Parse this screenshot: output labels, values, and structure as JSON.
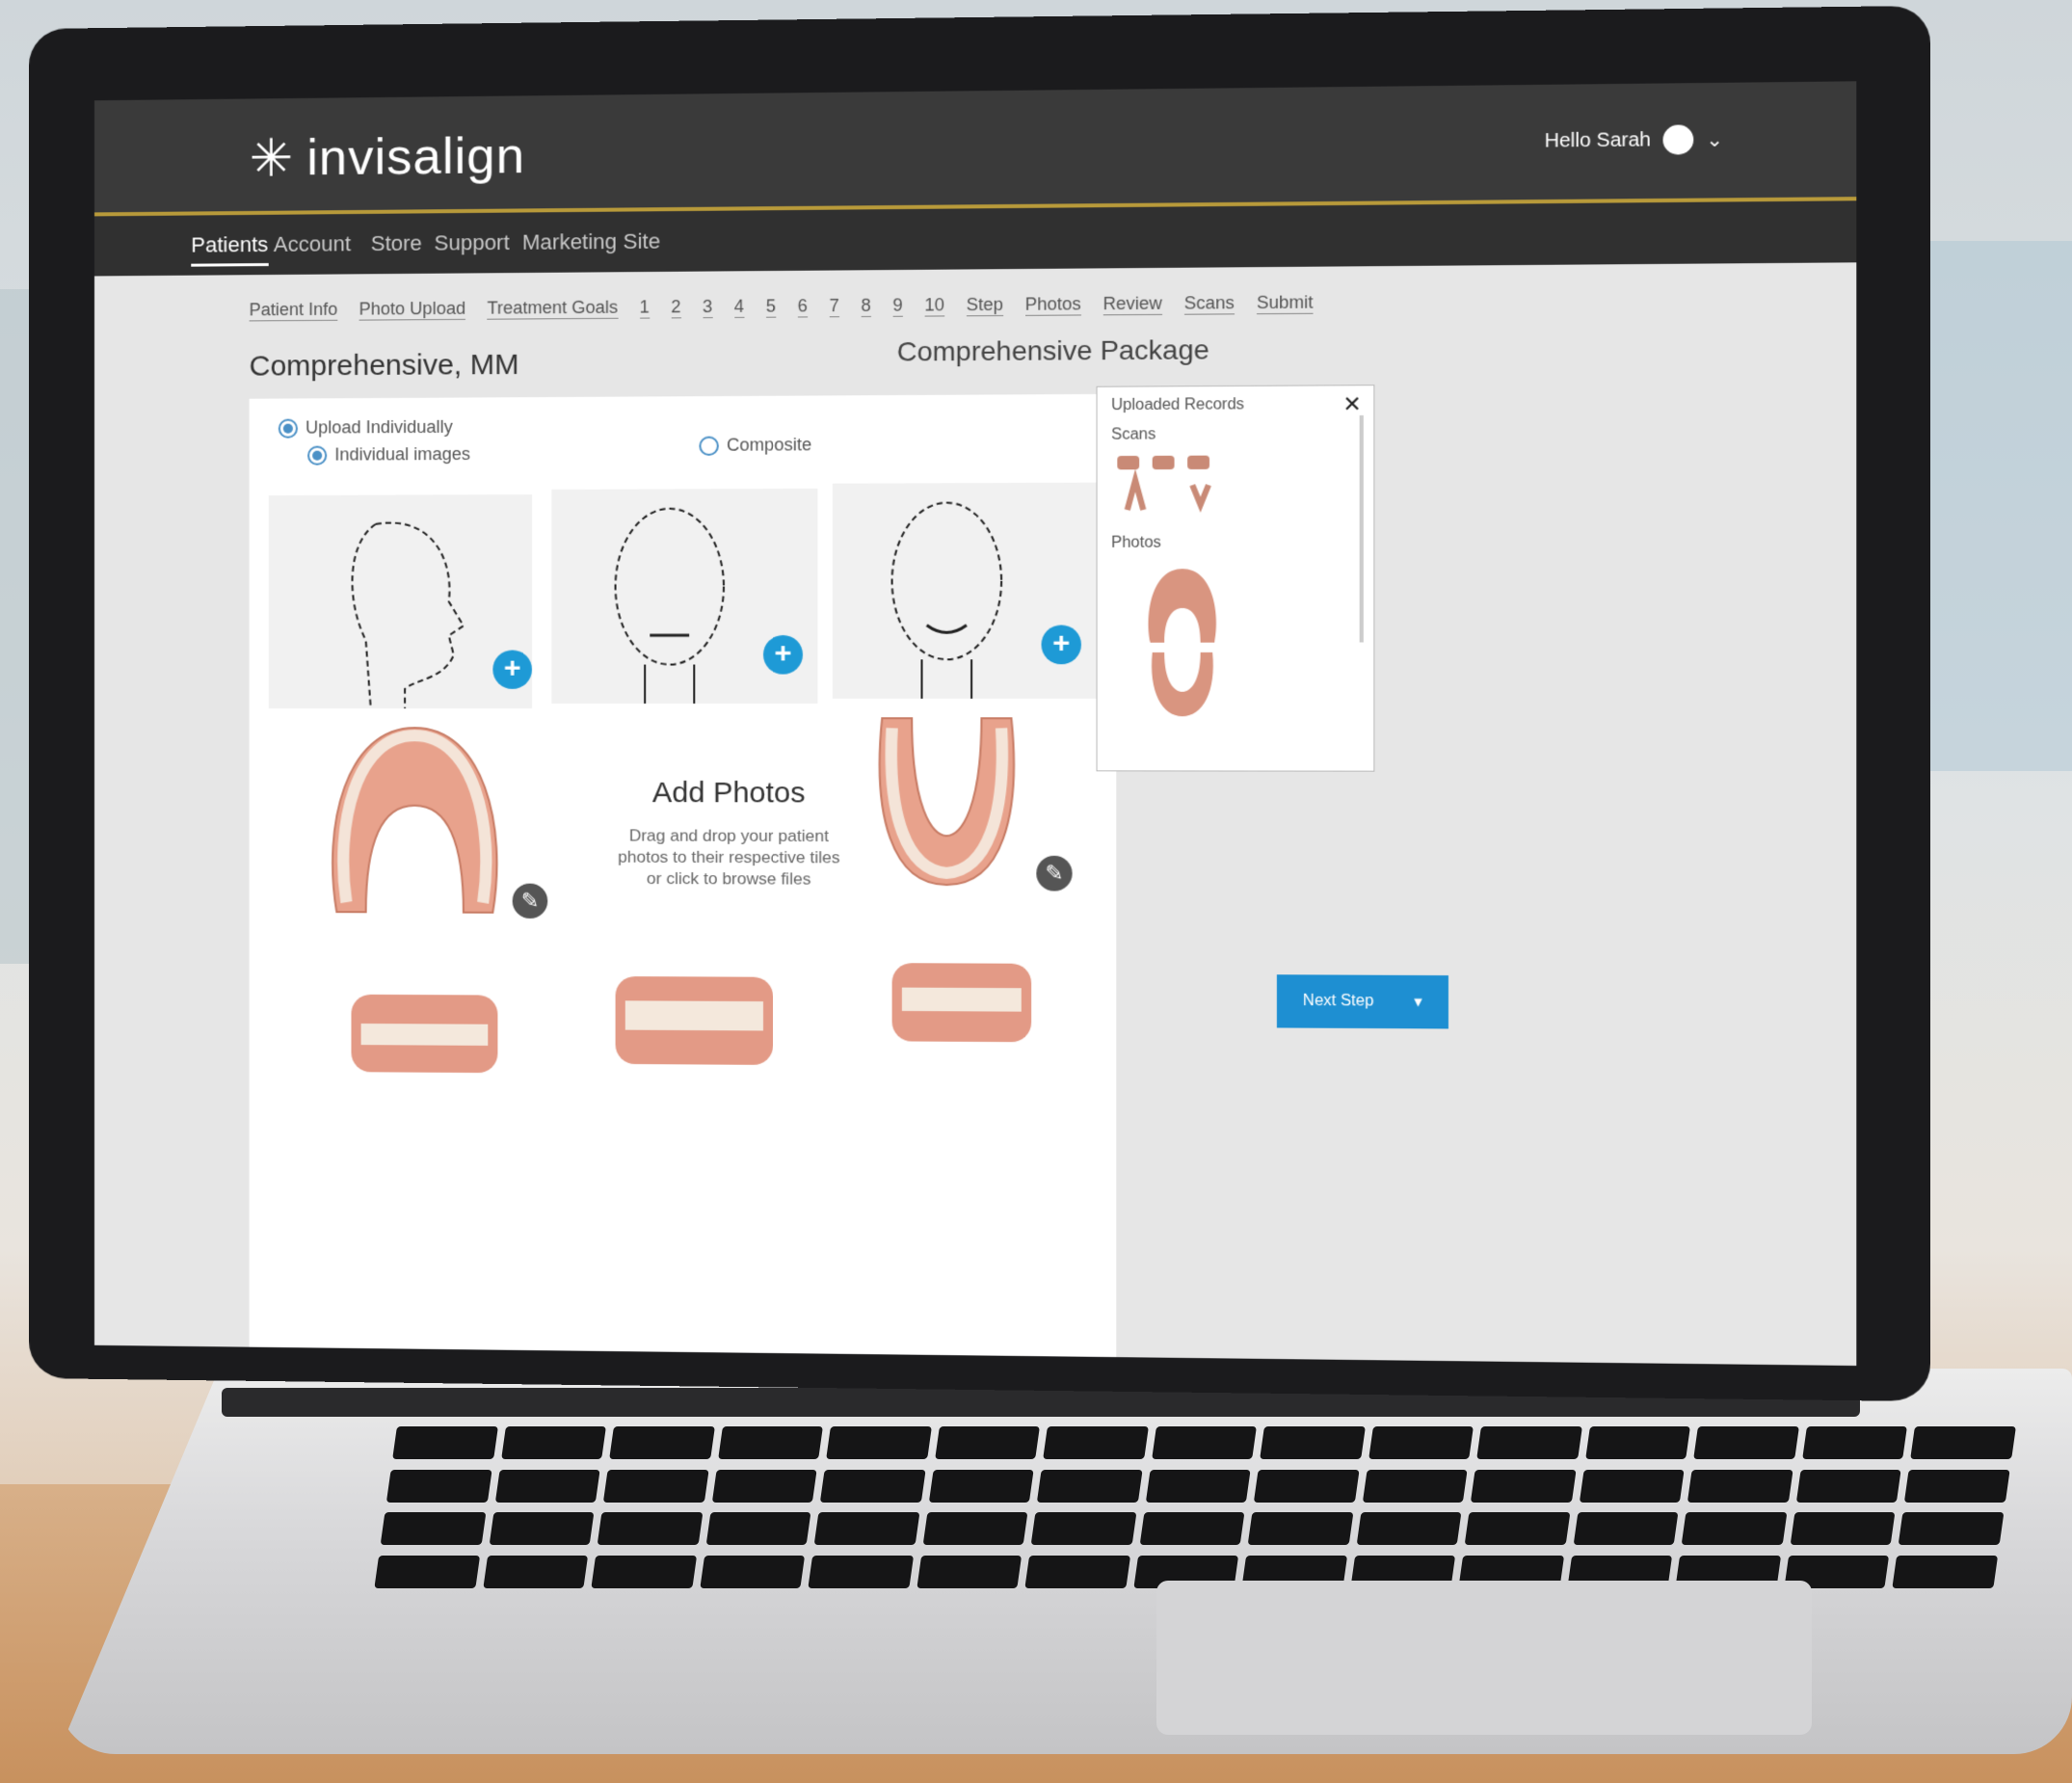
{
  "app": {
    "brand": "invisalign"
  },
  "header": {
    "user_label": "Hello Sarah"
  },
  "nav": {
    "items": [
      "Patients",
      "Account",
      "Store",
      "Support",
      "Marketing Site"
    ]
  },
  "steps": [
    "Patient Info",
    "Photo Upload",
    "Treatment Goals",
    "1",
    "2",
    "3",
    "4",
    "5",
    "6",
    "7",
    "8",
    "9",
    "10",
    "Step",
    "Photos",
    "Review",
    "Scans",
    "Submit"
  ],
  "patient": {
    "name": "Comprehensive, MM"
  },
  "package": {
    "label": "Comprehensive Package"
  },
  "upload": {
    "option_a": "Upload Individually",
    "option_a_sub": "Individual images",
    "option_b": "Composite"
  },
  "add_photos": {
    "title": "Add Photos",
    "description": "Drag and drop your patient photos to their respective tiles or click to browse files"
  },
  "side_panel": {
    "title": "Uploaded Records",
    "scans_label": "Scans",
    "photos_label": "Photos"
  },
  "actions": {
    "next": "Next Step"
  }
}
